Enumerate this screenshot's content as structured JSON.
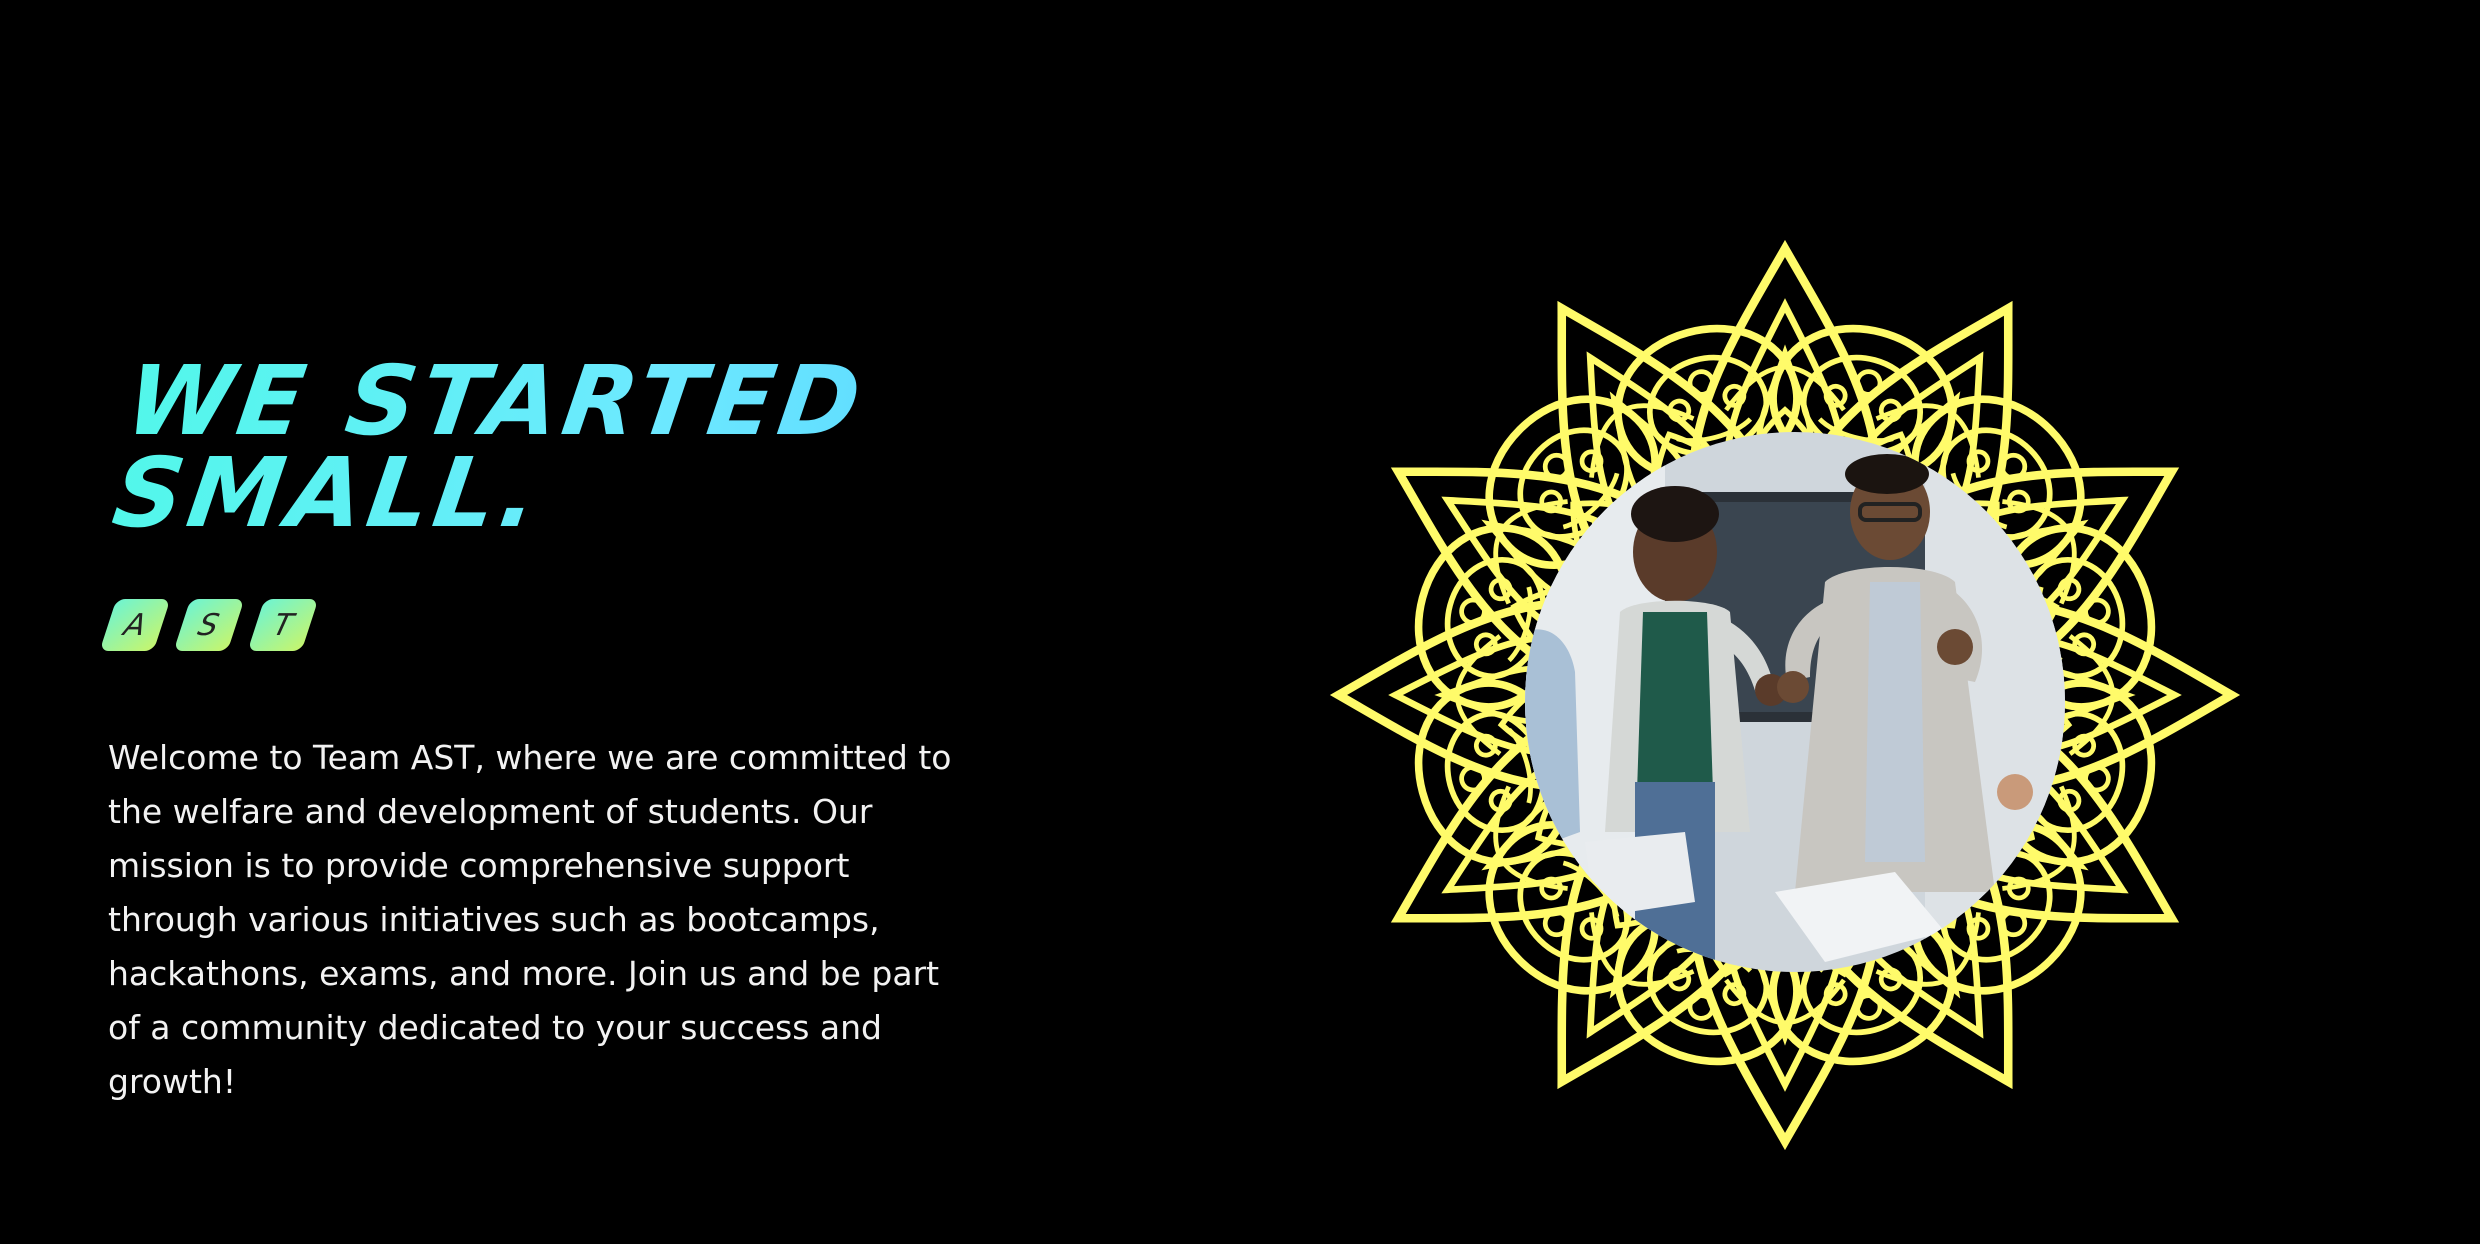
{
  "hero": {
    "headline_line1": "WE STARTED",
    "headline_line2": "SMALL.",
    "tags": [
      "A",
      "S",
      "T"
    ],
    "description": "Welcome to Team AST, where we are committed to the welfare and development of students. Our mission is to provide comprehensive support through various initiatives such as bootcamps, hackathons, exams, and more. Join us and be part of a community dedicated to your success and growth!"
  },
  "colors": {
    "background": "#000000",
    "headline": "#5cf2f2",
    "tag_gradient_start": "#6ef4d2",
    "tag_gradient_end": "#c8f56b",
    "mandala": "#fffb6a",
    "body_text": "#f2f2f2"
  },
  "images": {
    "mandala": "yellow-mandala-outline",
    "photo": "two-people-celebrating-office-photo"
  }
}
